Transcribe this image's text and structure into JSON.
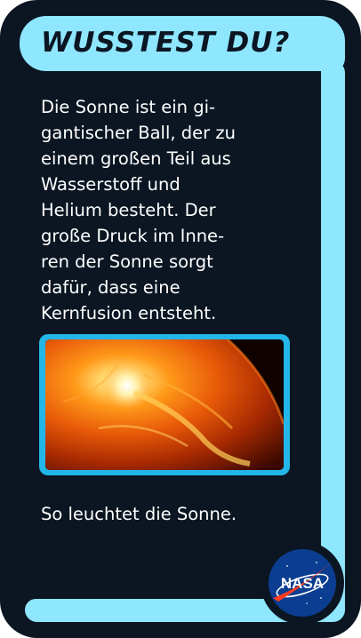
{
  "card": {
    "title": "WUSSTEST DU?",
    "body_lines": [
      "Die Sonne ist ein gi-",
      "gantischer Ball, der zu",
      "einem großen Teil aus",
      "Wasserstoff und",
      "Helium besteht. Der",
      "große Druck im Inne-",
      "ren der Sonne sorgt",
      "dafür, dass eine",
      "Kernfusion entsteht."
    ],
    "caption": "So leuchtet die Sonne.",
    "logo_text": "NASA"
  },
  "icons": {
    "image": "sun-photo",
    "logo": "nasa-logo-icon"
  },
  "colors": {
    "card_background": "#0b1622",
    "frame_accent": "#8fe6ff",
    "image_border": "#23b6e8",
    "text": "#ffffff",
    "logo_blue": "#0b3d91",
    "logo_red": "#fc3d21"
  }
}
